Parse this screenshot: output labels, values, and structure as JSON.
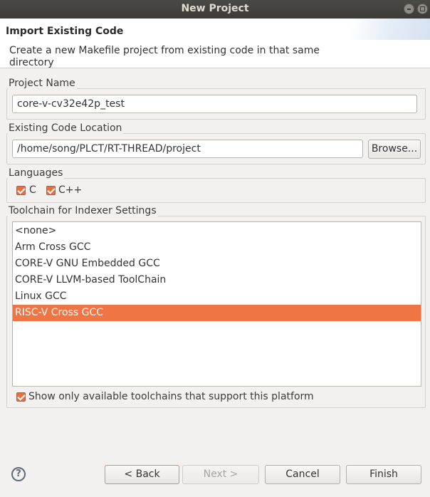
{
  "window": {
    "title": "New Project"
  },
  "header": {
    "title": "Import Existing Code",
    "description": "Create a new Makefile project from existing code in that same directory"
  },
  "project_name": {
    "label": "Project Name",
    "value": "core-v-cv32e42p_test"
  },
  "code_location": {
    "label": "Existing Code Location",
    "value": "/home/song/PLCT/RT-THREAD/project",
    "browse_label": "Browse..."
  },
  "languages": {
    "label": "Languages",
    "items": [
      {
        "label": "C",
        "checked": true
      },
      {
        "label": "C++",
        "checked": true
      }
    ]
  },
  "toolchain": {
    "label": "Toolchain for Indexer Settings",
    "items": [
      "<none>",
      "Arm Cross GCC",
      "CORE-V GNU Embedded GCC",
      "CORE-V LLVM-based ToolChain",
      "Linux GCC",
      "RISC-V Cross GCC"
    ],
    "selected": "RISC-V Cross GCC",
    "filter_label": "Show only available toolchains that support this platform",
    "filter_checked": true
  },
  "buttons": {
    "help": "?",
    "back": "< Back",
    "next": "Next >",
    "cancel": "Cancel",
    "finish": "Finish"
  },
  "colors": {
    "accent": "#ef7545",
    "titlebar": "#3c3b37"
  }
}
